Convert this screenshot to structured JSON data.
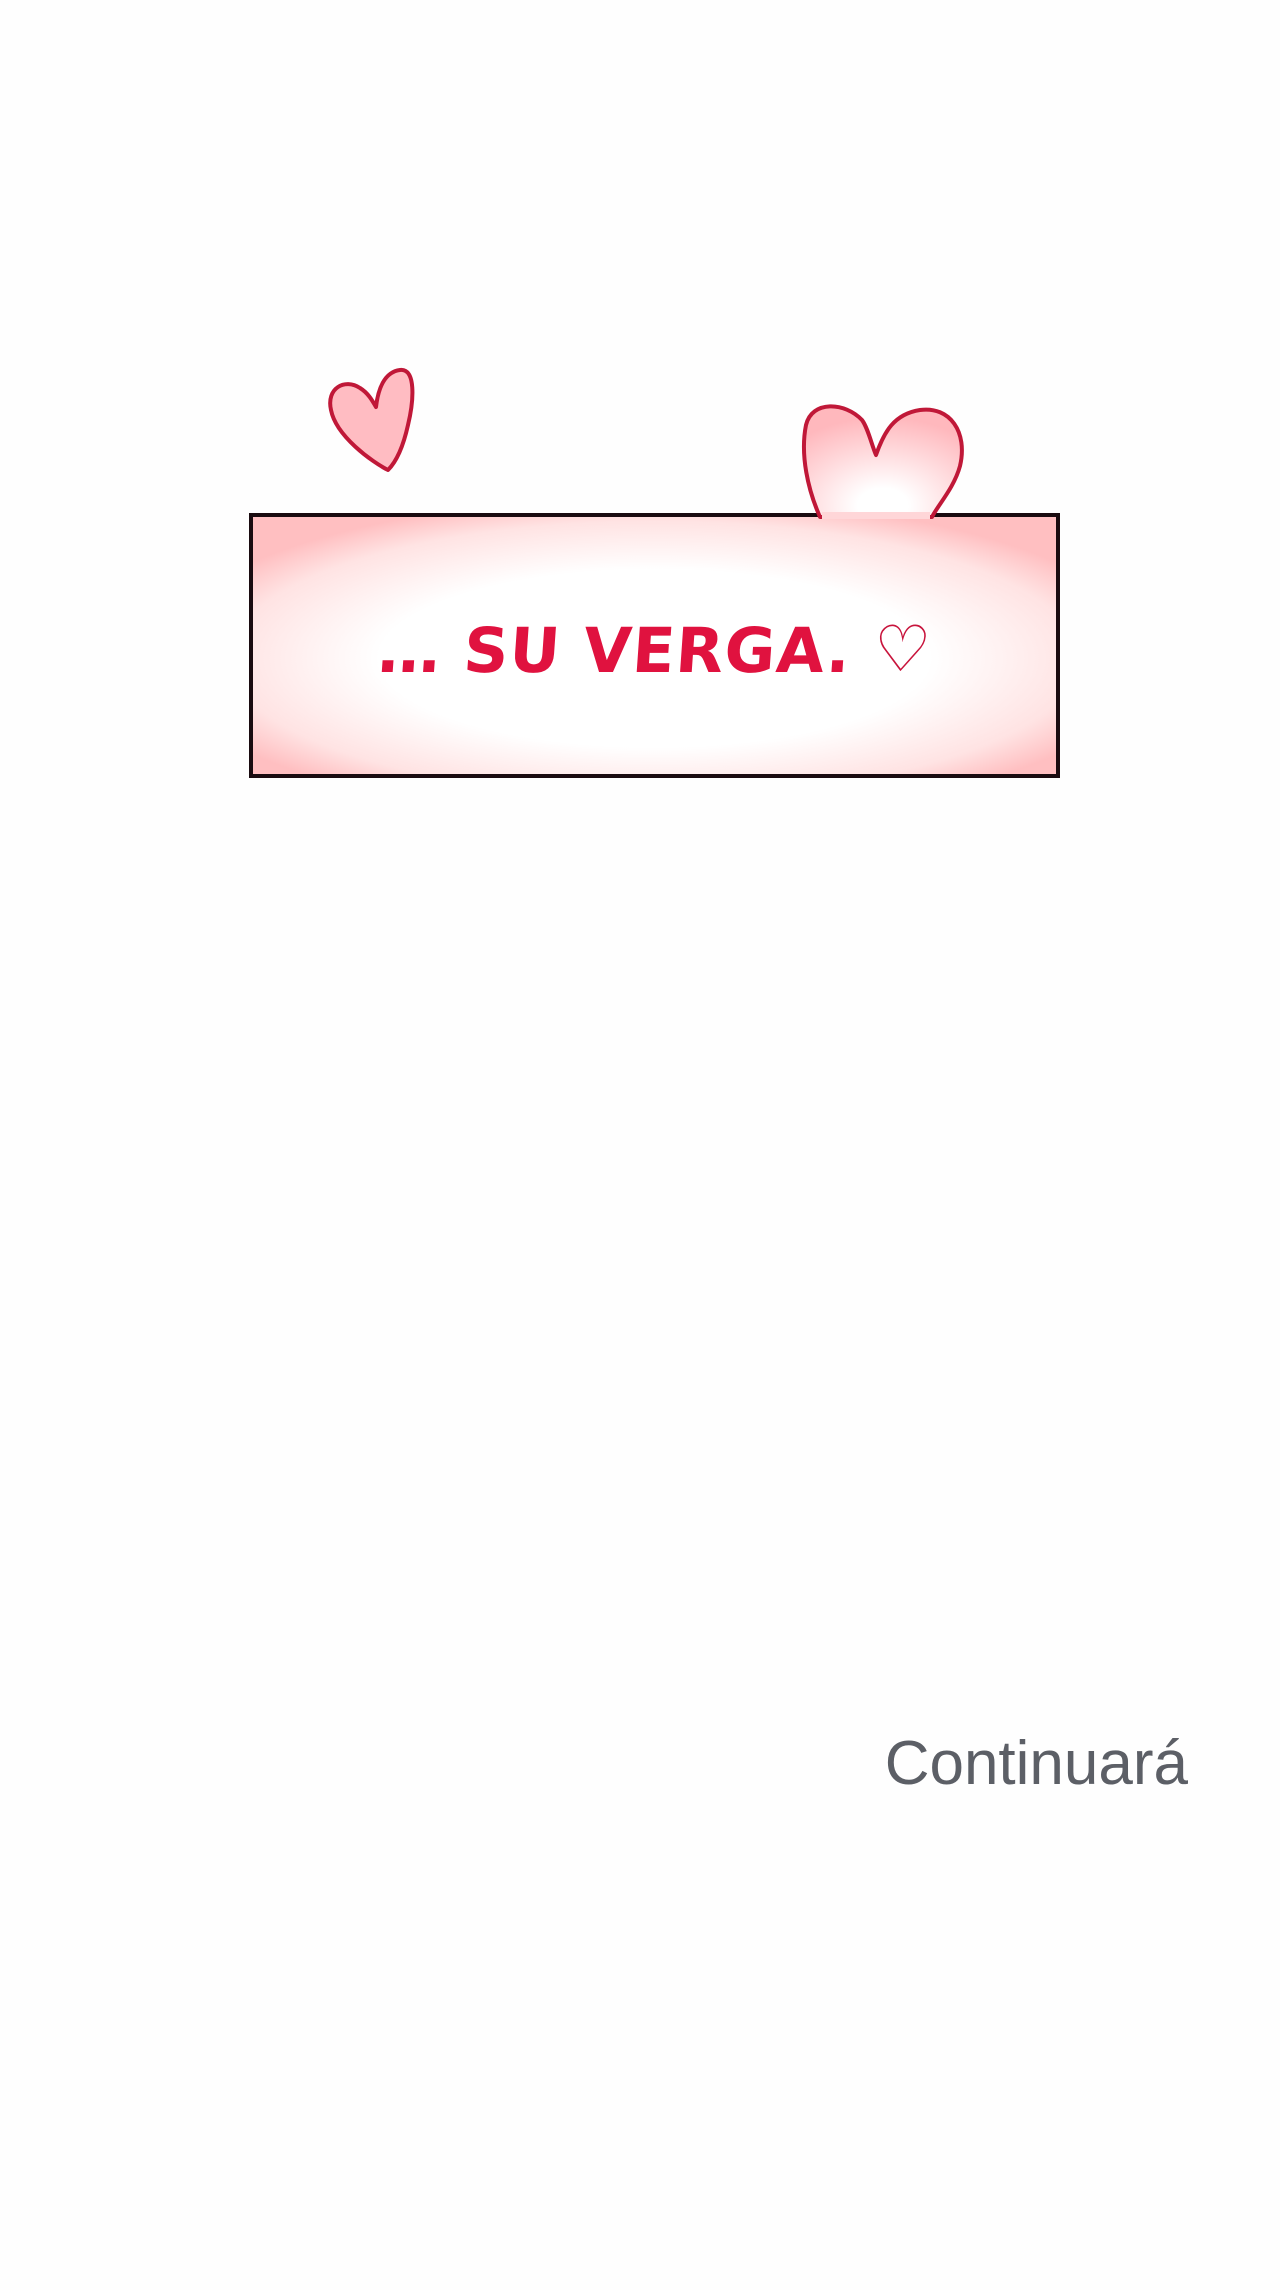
{
  "caption": {
    "text": "… SU VERGA.",
    "heart": "♡"
  },
  "footer": {
    "continue_label": "Continuará"
  },
  "icons": [
    "heart-icon-left",
    "heart-icon-right"
  ],
  "colors": {
    "frame_border": "#1a0b10",
    "frame_glow": "#ffc6c6",
    "caption_text": "#e0123f",
    "heart_fill": "#ffc2c6",
    "heart_stroke": "#c01838",
    "continue_text": "#5c5f66"
  }
}
